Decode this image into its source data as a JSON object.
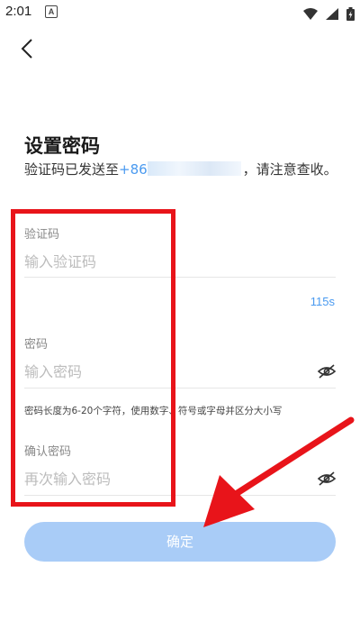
{
  "status_bar": {
    "time": "2:01",
    "notification_glyph": "A",
    "icons": [
      "wifi-icon",
      "signal-icon",
      "battery-icon"
    ]
  },
  "nav": {
    "back_icon": "chevron-left-icon"
  },
  "page": {
    "title": "设置密码",
    "subtitle_prefix": "验证码已发送至",
    "phone_visible": "+86",
    "subtitle_suffix": "，请注意查收。"
  },
  "form": {
    "code": {
      "label": "验证码",
      "placeholder": "输入验证码",
      "value": "",
      "countdown": "115s"
    },
    "password": {
      "label": "密码",
      "placeholder": "输入密码",
      "value": "",
      "hint": "密码长度为6-20个字符，使用数字、符号或字母并区分大小写"
    },
    "confirm_password": {
      "label": "确认密码",
      "placeholder": "再次输入密码",
      "value": ""
    }
  },
  "actions": {
    "confirm_label": "确定"
  },
  "colors": {
    "accent": "#4a9af0",
    "button_disabled": "#a9ccf7",
    "annotation_red": "#e8141a"
  }
}
